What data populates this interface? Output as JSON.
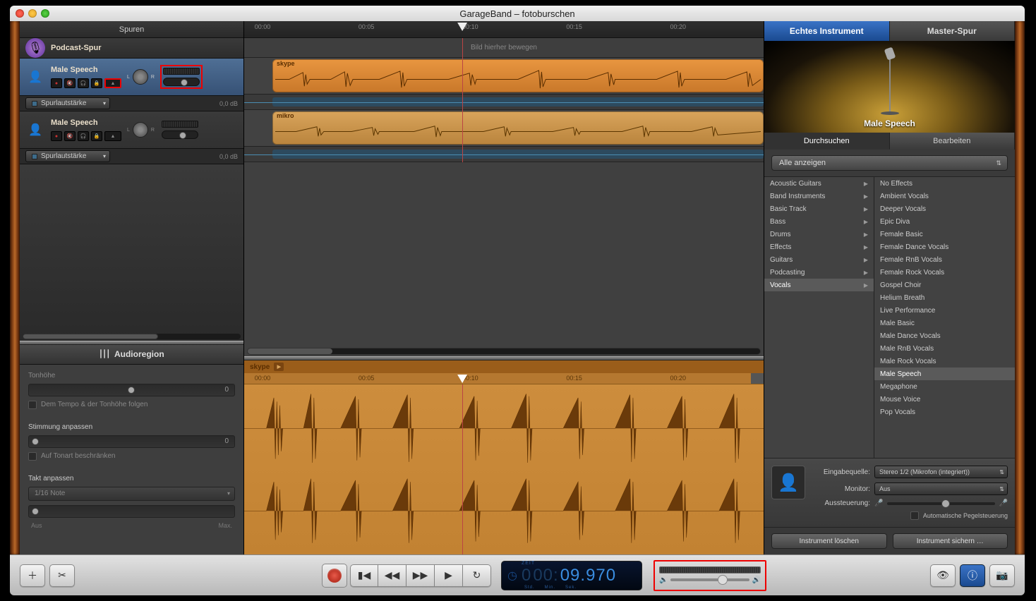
{
  "window_title": "GarageBand – fotoburschen",
  "tracks_header": "Spuren",
  "ruler_ticks": [
    "00:00",
    "00:05",
    "00:10",
    "00:15",
    "00:20"
  ],
  "playhead_pos_pct": 42,
  "podcast_lane_text": "Bild hierher bewegen",
  "tracks": {
    "podcast": {
      "name": "Podcast-Spur"
    },
    "t1": {
      "name": "Male Speech",
      "region_label": "skype",
      "spurlaut_label": "Spurlautstärke",
      "db_label": "0,0 dB"
    },
    "t2": {
      "name": "Male Speech",
      "region_label": "mikro",
      "spurlaut_label": "Spurlautstärke",
      "db_label": "0,0 dB"
    }
  },
  "editor": {
    "header": "Audioregion",
    "region_name": "skype",
    "pitch_label": "Tonhöhe",
    "pitch_value": "0",
    "follow_tempo_label": "Dem Tempo & der Tonhöhe folgen",
    "tuning_label": "Stimmung anpassen",
    "tuning_value": "0",
    "limit_key_label": "Auf Tonart beschränken",
    "timing_label": "Takt anpassen",
    "timing_note": "1/16 Note",
    "aus_label": "Aus",
    "max_label": "Max."
  },
  "right": {
    "tab_instrument": "Echtes Instrument",
    "tab_master": "Master-Spur",
    "instrument_name": "Male Speech",
    "tab_browse": "Durchsuchen",
    "tab_edit": "Bearbeiten",
    "filter_label": "Alle anzeigen",
    "categories": [
      "Acoustic Guitars",
      "Band Instruments",
      "Basic Track",
      "Bass",
      "Drums",
      "Effects",
      "Guitars",
      "Podcasting",
      "Vocals"
    ],
    "selected_category": "Vocals",
    "presets": [
      "No Effects",
      "Ambient Vocals",
      "Deeper Vocals",
      "Epic Diva",
      "Female Basic",
      "Female Dance Vocals",
      "Female RnB Vocals",
      "Female Rock Vocals",
      "Gospel Choir",
      "Helium Breath",
      "Live Performance",
      "Male Basic",
      "Male Dance Vocals",
      "Male RnB Vocals",
      "Male Rock Vocals",
      "Male Speech",
      "Megaphone",
      "Mouse Voice",
      "Pop Vocals"
    ],
    "selected_preset": "Male Speech",
    "input_label": "Eingabequelle:",
    "input_value": "Stereo 1/2 (Mikrofon (integriert))",
    "monitor_label": "Monitor:",
    "monitor_value": "Aus",
    "gain_label": "Aussteuerung:",
    "auto_level_label": "Automatische Pegelsteuerung",
    "btn_delete": "Instrument löschen",
    "btn_save": "Instrument sichern …"
  },
  "transport": {
    "zeit_label": "ZEIT",
    "time_hours": "0",
    "time_mins": "00:",
    "time_secs": "09.970",
    "units": [
      "Std.",
      "Min.",
      "Sek."
    ]
  }
}
